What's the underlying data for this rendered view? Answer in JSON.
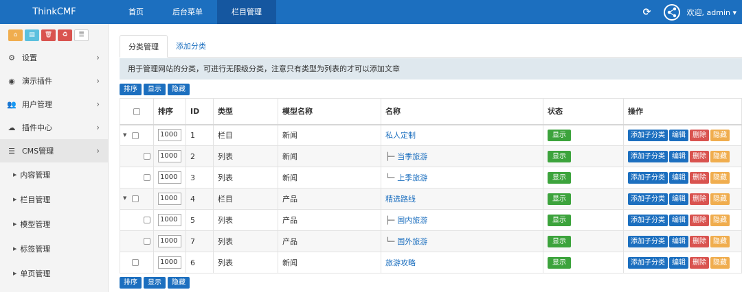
{
  "brand": "ThinkCMF",
  "topnav": [
    {
      "label": "首页"
    },
    {
      "label": "后台菜单"
    },
    {
      "label": "栏目管理"
    }
  ],
  "user": {
    "greeting": "欢迎, admin ▾"
  },
  "icons": {
    "refresh": "refresh-icon",
    "avatar": "share-avatar-icon"
  },
  "sidebar": {
    "menu": [
      {
        "label": "设置",
        "icon": "⚙"
      },
      {
        "label": "演示插件",
        "icon": "◉"
      },
      {
        "label": "用户管理",
        "icon": "👥"
      },
      {
        "label": "插件中心",
        "icon": "☁"
      },
      {
        "label": "CMS管理",
        "icon": "☰"
      }
    ],
    "sub": [
      {
        "label": "内容管理"
      },
      {
        "label": "栏目管理"
      },
      {
        "label": "模型管理"
      },
      {
        "label": "标签管理"
      },
      {
        "label": "单页管理"
      }
    ]
  },
  "tabs": [
    {
      "label": "分类管理"
    },
    {
      "label": "添加分类"
    }
  ],
  "notice": "用于管理网站的分类，可进行无限级分类，注意只有类型为列表的才可以添加文章",
  "actions": {
    "sort": "排序",
    "show": "显示",
    "hide": "隐藏"
  },
  "table": {
    "headers": [
      "排序",
      "ID",
      "类型",
      "模型名称",
      "名称",
      "状态",
      "操作"
    ],
    "rows": [
      {
        "order": "1000",
        "id": "1",
        "type": "栏目",
        "model": "新闻",
        "prefix": "",
        "name": "私人定制",
        "status": "显示"
      },
      {
        "order": "1000",
        "id": "2",
        "type": "列表",
        "model": "新闻",
        "prefix": "├─",
        "name": "当季旅游",
        "status": "显示"
      },
      {
        "order": "1000",
        "id": "3",
        "type": "列表",
        "model": "新闻",
        "prefix": "└─",
        "name": "上季旅游",
        "status": "显示"
      },
      {
        "order": "1000",
        "id": "4",
        "type": "栏目",
        "model": "产品",
        "prefix": "",
        "name": "精选路线",
        "status": "显示"
      },
      {
        "order": "1000",
        "id": "5",
        "type": "列表",
        "model": "产品",
        "prefix": "├─",
        "name": "国内旅游",
        "status": "显示"
      },
      {
        "order": "1000",
        "id": "7",
        "type": "列表",
        "model": "产品",
        "prefix": "└─",
        "name": "国外旅游",
        "status": "显示"
      },
      {
        "order": "1000",
        "id": "6",
        "type": "列表",
        "model": "新闻",
        "prefix": "",
        "name": "旅游攻略",
        "status": "显示"
      }
    ],
    "row_actions": {
      "add_child": "添加子分类",
      "edit": "编辑",
      "delete": "删除",
      "hide": "隐藏"
    }
  }
}
